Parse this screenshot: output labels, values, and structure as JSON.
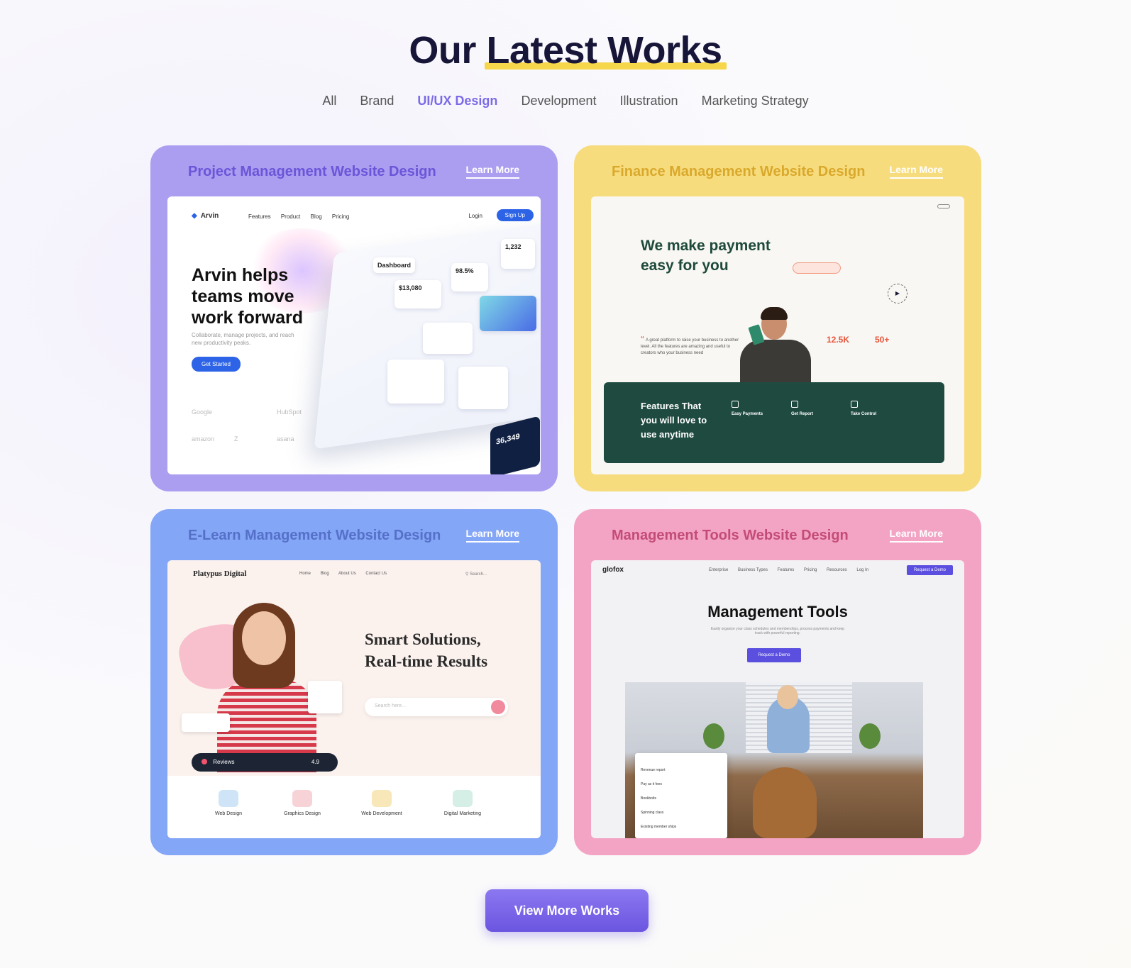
{
  "heading": {
    "prefix": "Our",
    "highlight": "Latest Works"
  },
  "filters": [
    "All",
    "Brand",
    "UI/UX Design",
    "Development",
    "Illustration",
    "Marketing Strategy"
  ],
  "active_filter": "UI/UX Design",
  "accent": "#7b6be6",
  "cards": [
    {
      "title": "Project Management Website Design",
      "link": "Learn More",
      "color": "#ab9df0"
    },
    {
      "title": "Finance Management Website Design",
      "link": "Learn More",
      "color": "#f7dc7e"
    },
    {
      "title": "E-Learn Management Website Design",
      "link": "Learn More",
      "color": "#84a6f6"
    },
    {
      "title": "Management Tools Website Design",
      "link": "Learn More",
      "color": "#f3a4c4"
    }
  ],
  "shot1": {
    "logo": "Arvin",
    "nav": [
      "Features",
      "Product",
      "Blog",
      "Pricing"
    ],
    "login": "Login",
    "signup": "Sign Up",
    "headline": "Arvin helps teams move work forward",
    "body": "Collaborate, manage projects, and reach new productivity peaks.",
    "cta": "Get Started",
    "brands": [
      "Google",
      "",
      "HubSpot",
      "amazon",
      "Z",
      "asana"
    ],
    "tiles": [
      "Dashboard",
      "$13,080",
      "98.5%",
      "1,232"
    ],
    "dark_value": "36,349"
  },
  "shot2": {
    "headline": "We make payment easy for you",
    "stat1": "12.5K",
    "stat2": "50+",
    "quote": "A great platform to raise your business to another level. All the features are amazing and useful to creators who your business need",
    "band_title": "Features That you will love to use anytime",
    "features": [
      "Easy Payments",
      "Get Report",
      "Take Control"
    ]
  },
  "shot3": {
    "brand": "Platypus Digital",
    "nav": [
      "Home",
      "Blog",
      "About Us",
      "Contact Us"
    ],
    "search": "Search...",
    "headline_1": "Smart Solutions,",
    "headline_2": "Real-time Results",
    "search_placeholder": "Search here...",
    "reviews": "Reviews",
    "score": "4.9",
    "services": [
      "Web Design",
      "Graphics Design",
      "Web Development",
      "Digital Marketing"
    ]
  },
  "shot4": {
    "logo": "glofox",
    "nav": [
      "Enterprise",
      "Business Types",
      "Features",
      "Pricing",
      "Resources"
    ],
    "login": "Log In",
    "cta_top": "Request a Demo",
    "headline": "Management Tools",
    "body": "Easily organize your class schedules and memberships, process payments and keep track with powerful reporting.",
    "cta": "Request a Demo",
    "report_title": "Revenue report",
    "report_rows": [
      "Pay as it fees",
      "Bookbolts",
      "Spinning class",
      "Existing member ships"
    ]
  },
  "cta_button": "View More Works"
}
